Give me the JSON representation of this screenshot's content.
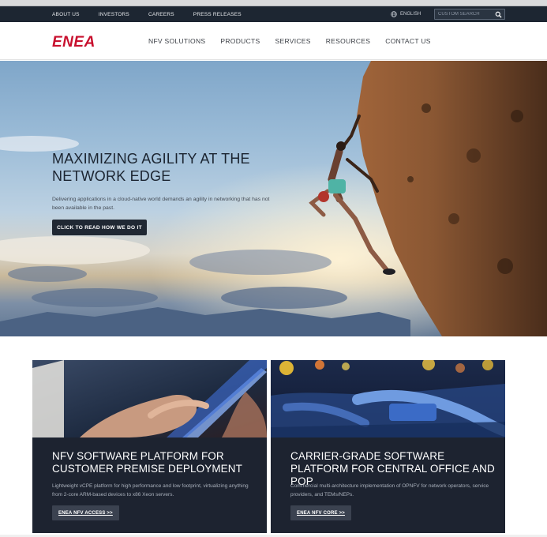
{
  "topbar": {
    "links": [
      "ABOUT US",
      "INVESTORS",
      "CAREERS",
      "PRESS RELEASES"
    ],
    "language": "ENGLISH",
    "search_placeholder": "CUSTOM SEARCH"
  },
  "nav": {
    "logo": "ENEA",
    "items": [
      "NFV SOLUTIONS",
      "PRODUCTS",
      "SERVICES",
      "RESOURCES",
      "CONTACT US"
    ]
  },
  "hero": {
    "title": "MAXIMIZING AGILITY AT THE NETWORK EDGE",
    "description": "Delivering applications in a cloud-native world demands an agility in networking that has not been available in the past.",
    "button": "CLICK TO READ HOW WE DO IT"
  },
  "cards": [
    {
      "title": "NFV SOFTWARE PLATFORM FOR CUSTOMER PREMISE DEPLOYMENT",
      "description": "Lightweight vCPE platform for high performance and low footprint, virtualizing anything from 2-core ARM-based devices to x86 Xeon servers.",
      "button": "ENEA NFV ACCESS >>"
    },
    {
      "title": "CARRIER-GRADE SOFTWARE PLATFORM FOR CENTRAL OFFICE AND POP",
      "description": "Commercial multi-architecture implementation of OPNFV for network operators, service providers, and TEMs/NEPs.",
      "button": "ENEA NFV CORE >>"
    }
  ],
  "colors": {
    "topbar_bg": "#1d2632",
    "brand_red": "#c8102e",
    "card_bg": "#1d2330",
    "button_dark": "#202833"
  }
}
